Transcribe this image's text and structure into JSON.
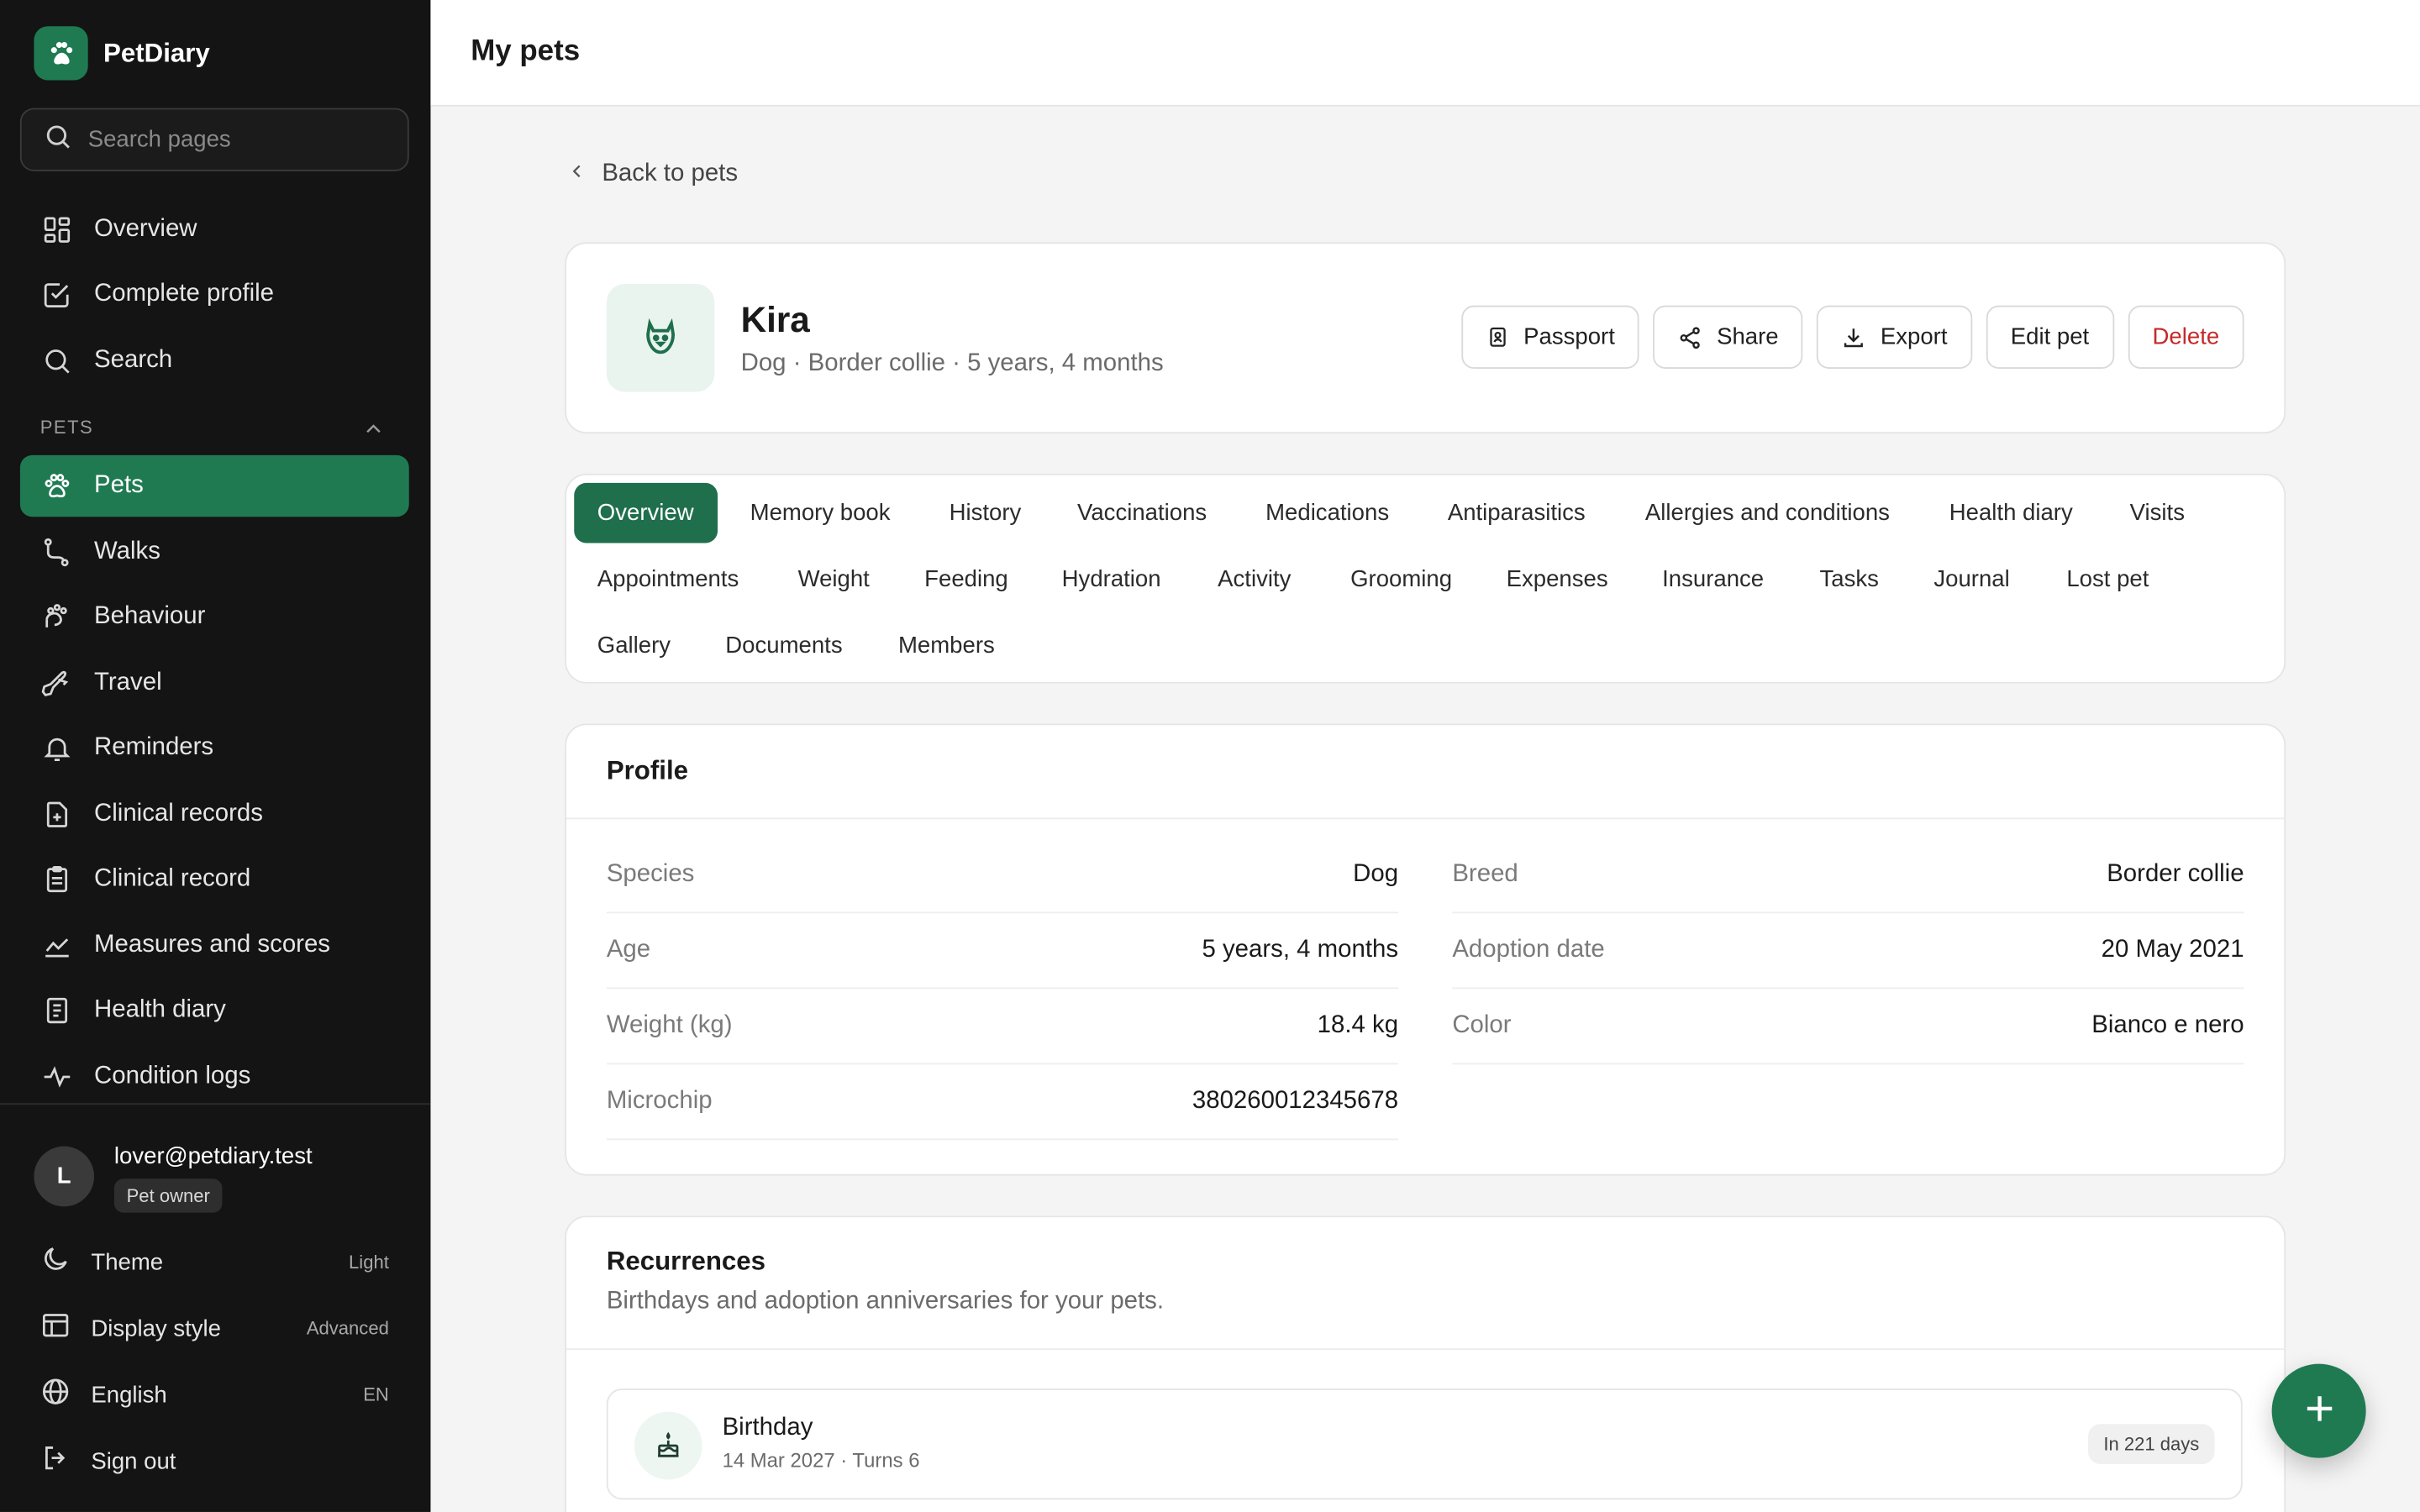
{
  "app": {
    "name": "PetDiary",
    "logo_icon": "paw-icon"
  },
  "sidebar": {
    "search_placeholder": "Search pages",
    "top_items": [
      {
        "label": "Overview",
        "icon": "grid-icon"
      },
      {
        "label": "Complete profile",
        "icon": "check-square-icon"
      },
      {
        "label": "Search",
        "icon": "search-icon"
      }
    ],
    "section": {
      "label": "PETS",
      "collapse_icon": "chevron-up-icon"
    },
    "pet_items": [
      {
        "label": "Pets",
        "icon": "paw-icon",
        "active": true
      },
      {
        "label": "Walks",
        "icon": "route-icon"
      },
      {
        "label": "Behaviour",
        "icon": "paw-print-icon"
      },
      {
        "label": "Travel",
        "icon": "plane-icon"
      },
      {
        "label": "Reminders",
        "icon": "bell-icon"
      },
      {
        "label": "Clinical records",
        "icon": "file-plus-icon"
      },
      {
        "label": "Clinical record",
        "icon": "clipboard-icon"
      },
      {
        "label": "Measures and scores",
        "icon": "chart-line-icon"
      },
      {
        "label": "Health diary",
        "icon": "notebook-icon"
      },
      {
        "label": "Condition logs",
        "icon": "activity-icon"
      }
    ],
    "user": {
      "initial": "L",
      "email": "lover@petdiary.test",
      "role": "Pet owner"
    },
    "settings": [
      {
        "label": "Theme",
        "value": "Light",
        "icon": "moon-icon"
      },
      {
        "label": "Display style",
        "value": "Advanced",
        "icon": "layout-icon"
      },
      {
        "label": "English",
        "value": "EN",
        "icon": "globe-icon"
      },
      {
        "label": "Sign out",
        "value": "",
        "icon": "sign-out-icon"
      }
    ]
  },
  "header": {
    "title": "My pets"
  },
  "back": {
    "label": "Back to pets"
  },
  "pet": {
    "name": "Kira",
    "subtitle": "Dog · Border collie · 5 years, 4 months",
    "avatar_icon": "dog-icon",
    "actions": {
      "passport": "Passport",
      "share": "Share",
      "export": "Export",
      "edit": "Edit pet",
      "delete": "Delete"
    }
  },
  "tabs": [
    "Overview",
    "Memory book",
    "History",
    "Vaccinations",
    "Medications",
    "Antiparasitics",
    "Allergies and conditions",
    "Health diary",
    "Visits",
    "Appointments",
    "Weight",
    "Feeding",
    "Hydration",
    "Activity",
    "Grooming",
    "Expenses",
    "Insurance",
    "Tasks",
    "Journal",
    "Lost pet",
    "Gallery",
    "Documents",
    "Members"
  ],
  "active_tab": "Overview",
  "profile": {
    "title": "Profile",
    "fields": [
      {
        "label": "Species",
        "value": "Dog"
      },
      {
        "label": "Breed",
        "value": "Border collie"
      },
      {
        "label": "Age",
        "value": "5 years, 4 months"
      },
      {
        "label": "Adoption date",
        "value": "20 May 2021"
      },
      {
        "label": "Weight (kg)",
        "value": "18.4 kg"
      },
      {
        "label": "Color",
        "value": "Bianco e nero"
      },
      {
        "label": "Microchip",
        "value": "380260012345678"
      }
    ]
  },
  "recurrences": {
    "title": "Recurrences",
    "subtitle": "Birthdays and adoption anniversaries for your pets.",
    "items": [
      {
        "name": "Birthday",
        "detail": "14 Mar 2027 · Turns 6",
        "badge": "In 221 days",
        "icon": "cake-icon"
      }
    ]
  },
  "fab": {
    "icon": "plus-icon"
  },
  "colors": {
    "accent": "#1f7a52",
    "sidebar_bg": "#141414",
    "danger": "#c62828"
  }
}
